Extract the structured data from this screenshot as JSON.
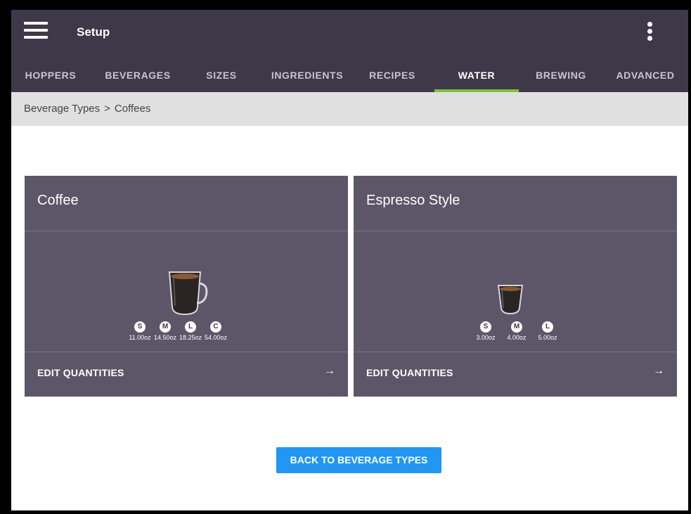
{
  "appbar": {
    "title": "Setup"
  },
  "tabs": [
    {
      "label": "HOPPERS"
    },
    {
      "label": "BEVERAGES"
    },
    {
      "label": "SIZES"
    },
    {
      "label": "INGREDIENTS"
    },
    {
      "label": "RECIPES"
    },
    {
      "label": "WATER",
      "active": true
    },
    {
      "label": "BREWING"
    },
    {
      "label": "ADVANCED"
    }
  ],
  "breadcrumb": {
    "parent": "Beverage Types",
    "separator": ">",
    "current": "Coffees"
  },
  "cards": [
    {
      "title": "Coffee",
      "edit_label": "EDIT QUANTITIES",
      "arrow": "→",
      "sizes": [
        {
          "badge": "S",
          "oz": "11.00oz"
        },
        {
          "badge": "M",
          "oz": "14.50oz"
        },
        {
          "badge": "L",
          "oz": "18.25oz"
        },
        {
          "badge": "C",
          "oz": "54.00oz"
        }
      ]
    },
    {
      "title": "Espresso Style",
      "edit_label": "EDIT QUANTITIES",
      "arrow": "→",
      "sizes": [
        {
          "badge": "S",
          "oz": "3.00oz"
        },
        {
          "badge": "M",
          "oz": "4.00oz"
        },
        {
          "badge": "L",
          "oz": "5.00oz"
        }
      ]
    }
  ],
  "back_button": {
    "label": "BACK TO BEVERAGE TYPES"
  },
  "colors": {
    "appbar": "#3e3848",
    "card": "#5d5668",
    "tab_indicator": "#7cc03a",
    "primary_button": "#2196f3"
  }
}
